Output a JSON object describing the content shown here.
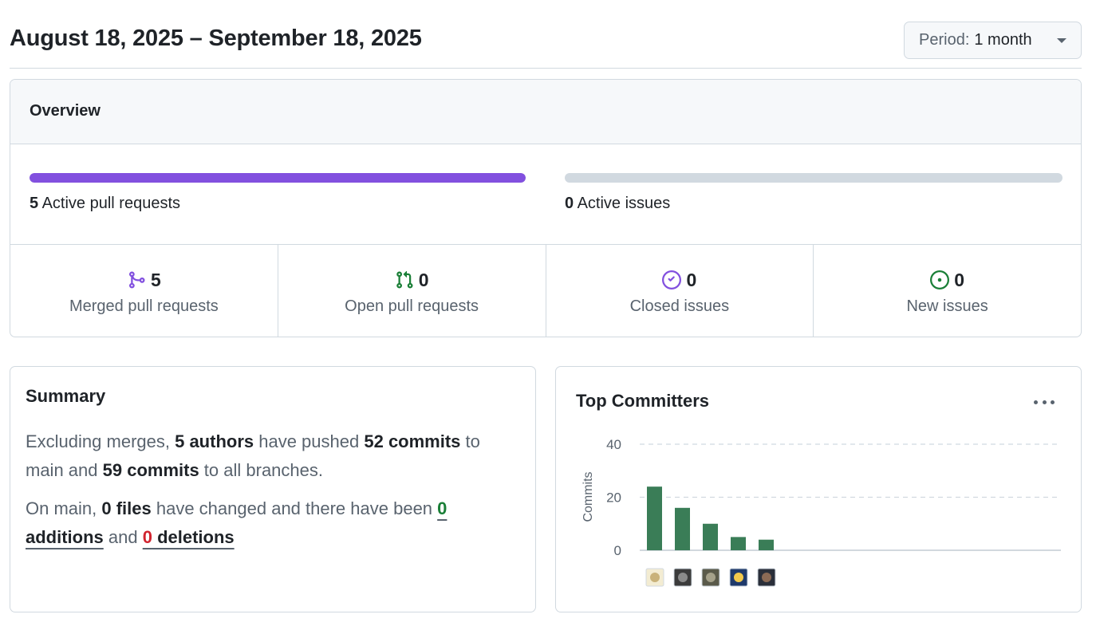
{
  "header": {
    "date_range": "August 18, 2025 – September 18, 2025",
    "period_label": "Period:",
    "period_value": "1 month"
  },
  "overview": {
    "title": "Overview",
    "active_prs": {
      "count": "5",
      "label": "Active pull requests",
      "fill_fraction": 1.0,
      "color": "#8250df"
    },
    "active_issues": {
      "count": "0",
      "label": "Active issues",
      "fill_fraction": 0.0,
      "color": "#1a7f37"
    },
    "stats": [
      {
        "icon": "merged-pr-icon",
        "count": "5",
        "label": "Merged pull requests",
        "color": "#8250df"
      },
      {
        "icon": "open-pr-icon",
        "count": "0",
        "label": "Open pull requests",
        "color": "#1a7f37"
      },
      {
        "icon": "closed-issue-icon",
        "count": "0",
        "label": "Closed issues",
        "color": "#8250df"
      },
      {
        "icon": "new-issue-icon",
        "count": "0",
        "label": "New issues",
        "color": "#1a7f37"
      }
    ]
  },
  "summary": {
    "title": "Summary",
    "p1_a": "Excluding merges, ",
    "authors": "5 authors",
    "p1_b": " have pushed ",
    "commits_main": "52 commits",
    "p1_c": " to main and ",
    "commits_all": "59 commits",
    "p1_d": " to all branches.",
    "p2_a": "On main, ",
    "files": "0 files",
    "p2_b": " have changed and there have been ",
    "additions_num": "0",
    "additions_word": " additions",
    "p2_c": " and ",
    "deletions_num": "0",
    "deletions_word": " deletions"
  },
  "committers": {
    "title": "Top Committers",
    "chart_data": {
      "type": "bar",
      "ylabel": "Commits",
      "ylim": [
        0,
        40
      ],
      "yticks": [
        0,
        20,
        40
      ],
      "values": [
        24,
        16,
        10,
        5,
        4
      ],
      "grid": true,
      "color": "#3a7d57"
    },
    "avatars": [
      "avatar-1",
      "avatar-2",
      "avatar-3",
      "avatar-4",
      "avatar-5"
    ]
  }
}
